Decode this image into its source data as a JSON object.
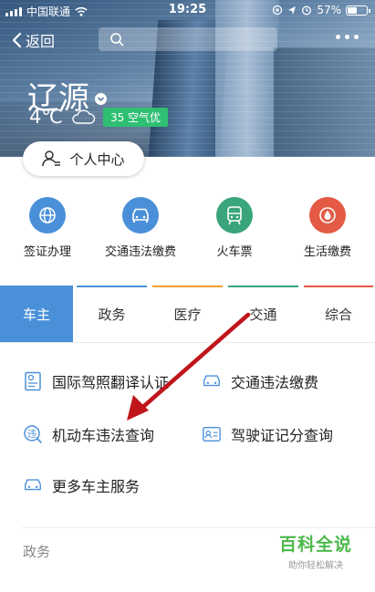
{
  "status_bar": {
    "carrier": "中国联通",
    "time": "19:25",
    "battery_percent": "57%",
    "battery_level": 0.57
  },
  "nav": {
    "back_label": "返回"
  },
  "city": {
    "name": "辽源",
    "temperature": "4℃",
    "aqi": "35 空气优"
  },
  "personal_center": {
    "label": "个人中心"
  },
  "quick_services": [
    {
      "label": "签证办理",
      "icon": "globe-icon",
      "color": "#4a90d9"
    },
    {
      "label": "交通违法缴费",
      "icon": "car-icon",
      "color": "#4a90d9"
    },
    {
      "label": "火车票",
      "icon": "train-icon",
      "color": "#3aa57a"
    },
    {
      "label": "生活缴费",
      "icon": "water-drop-icon",
      "color": "#e55a44"
    }
  ],
  "tabs": [
    {
      "label": "车主",
      "active": true,
      "accent": "#4a90d9"
    },
    {
      "label": "政务",
      "active": false,
      "accent": "#4a90d9"
    },
    {
      "label": "医疗",
      "active": false,
      "accent": "#f0a030"
    },
    {
      "label": "交通",
      "active": false,
      "accent": "#3aa57a"
    },
    {
      "label": "综合",
      "active": false,
      "accent": "#e55a44"
    }
  ],
  "services": [
    {
      "label": "国际驾照翻译认证",
      "icon": "document-icon"
    },
    {
      "label": "交通违法缴费",
      "icon": "car-icon"
    },
    {
      "label": "机动车违法查询",
      "icon": "violation-search-icon"
    },
    {
      "label": "驾驶证记分查询",
      "icon": "license-card-icon"
    },
    {
      "label": "更多车主服务",
      "icon": "car-icon"
    }
  ],
  "section_title": "政务",
  "watermark": {
    "title": "百科全说",
    "subtitle": "助你轻松解决"
  },
  "colors": {
    "accent": "#4a90d9",
    "aqi_badge": "#2fbf73",
    "watermark": "#4cb84a",
    "arrow": "#c0151b"
  }
}
